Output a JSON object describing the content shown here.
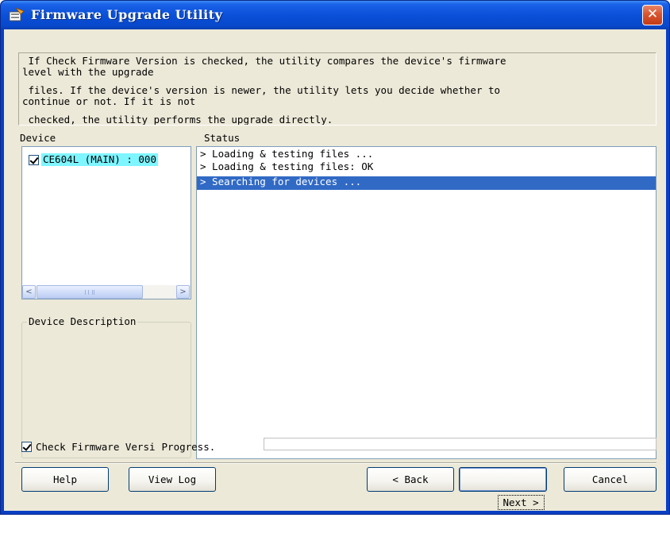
{
  "window": {
    "title": "Firmware Upgrade Utility",
    "close_glyph": "✕",
    "app_icon": "firmware-utility-icon"
  },
  "description": {
    "lines": [
      " If Check Firmware Version is checked, the utility compares the device's firmware",
      "level with the upgrade",
      " files. If the device's version is newer, the utility lets you decide whether to",
      "continue or not. If it is not",
      " checked, the utility performs the upgrade directly."
    ]
  },
  "device_panel": {
    "header": "Device",
    "items": [
      {
        "label": "CE604L (MAIN) : 000",
        "checked": true
      }
    ],
    "scroll_left": "<",
    "scroll_right": ">",
    "description_title": "Device Description"
  },
  "status_panel": {
    "header": "Status",
    "lines": [
      {
        "text": "> Loading & testing files ...",
        "selected": false
      },
      {
        "text": "> Loading & testing files: OK",
        "selected": false
      },
      {
        "text": "> Searching for devices ...",
        "selected": true
      }
    ]
  },
  "options": {
    "check_firmware_label": "Check Firmware Versi",
    "check_firmware_checked": true,
    "progress_label": "Progress.",
    "progress_value": 0
  },
  "buttons": {
    "help": "Help",
    "view_log": "View Log",
    "back": "< Back",
    "next": "Next >",
    "cancel": "Cancel"
  },
  "colors": {
    "titlebar": "#0a50d8",
    "selection": "#316ac5",
    "device_highlight": "#7ff5ff",
    "dialog_bg": "#ece9d8"
  }
}
